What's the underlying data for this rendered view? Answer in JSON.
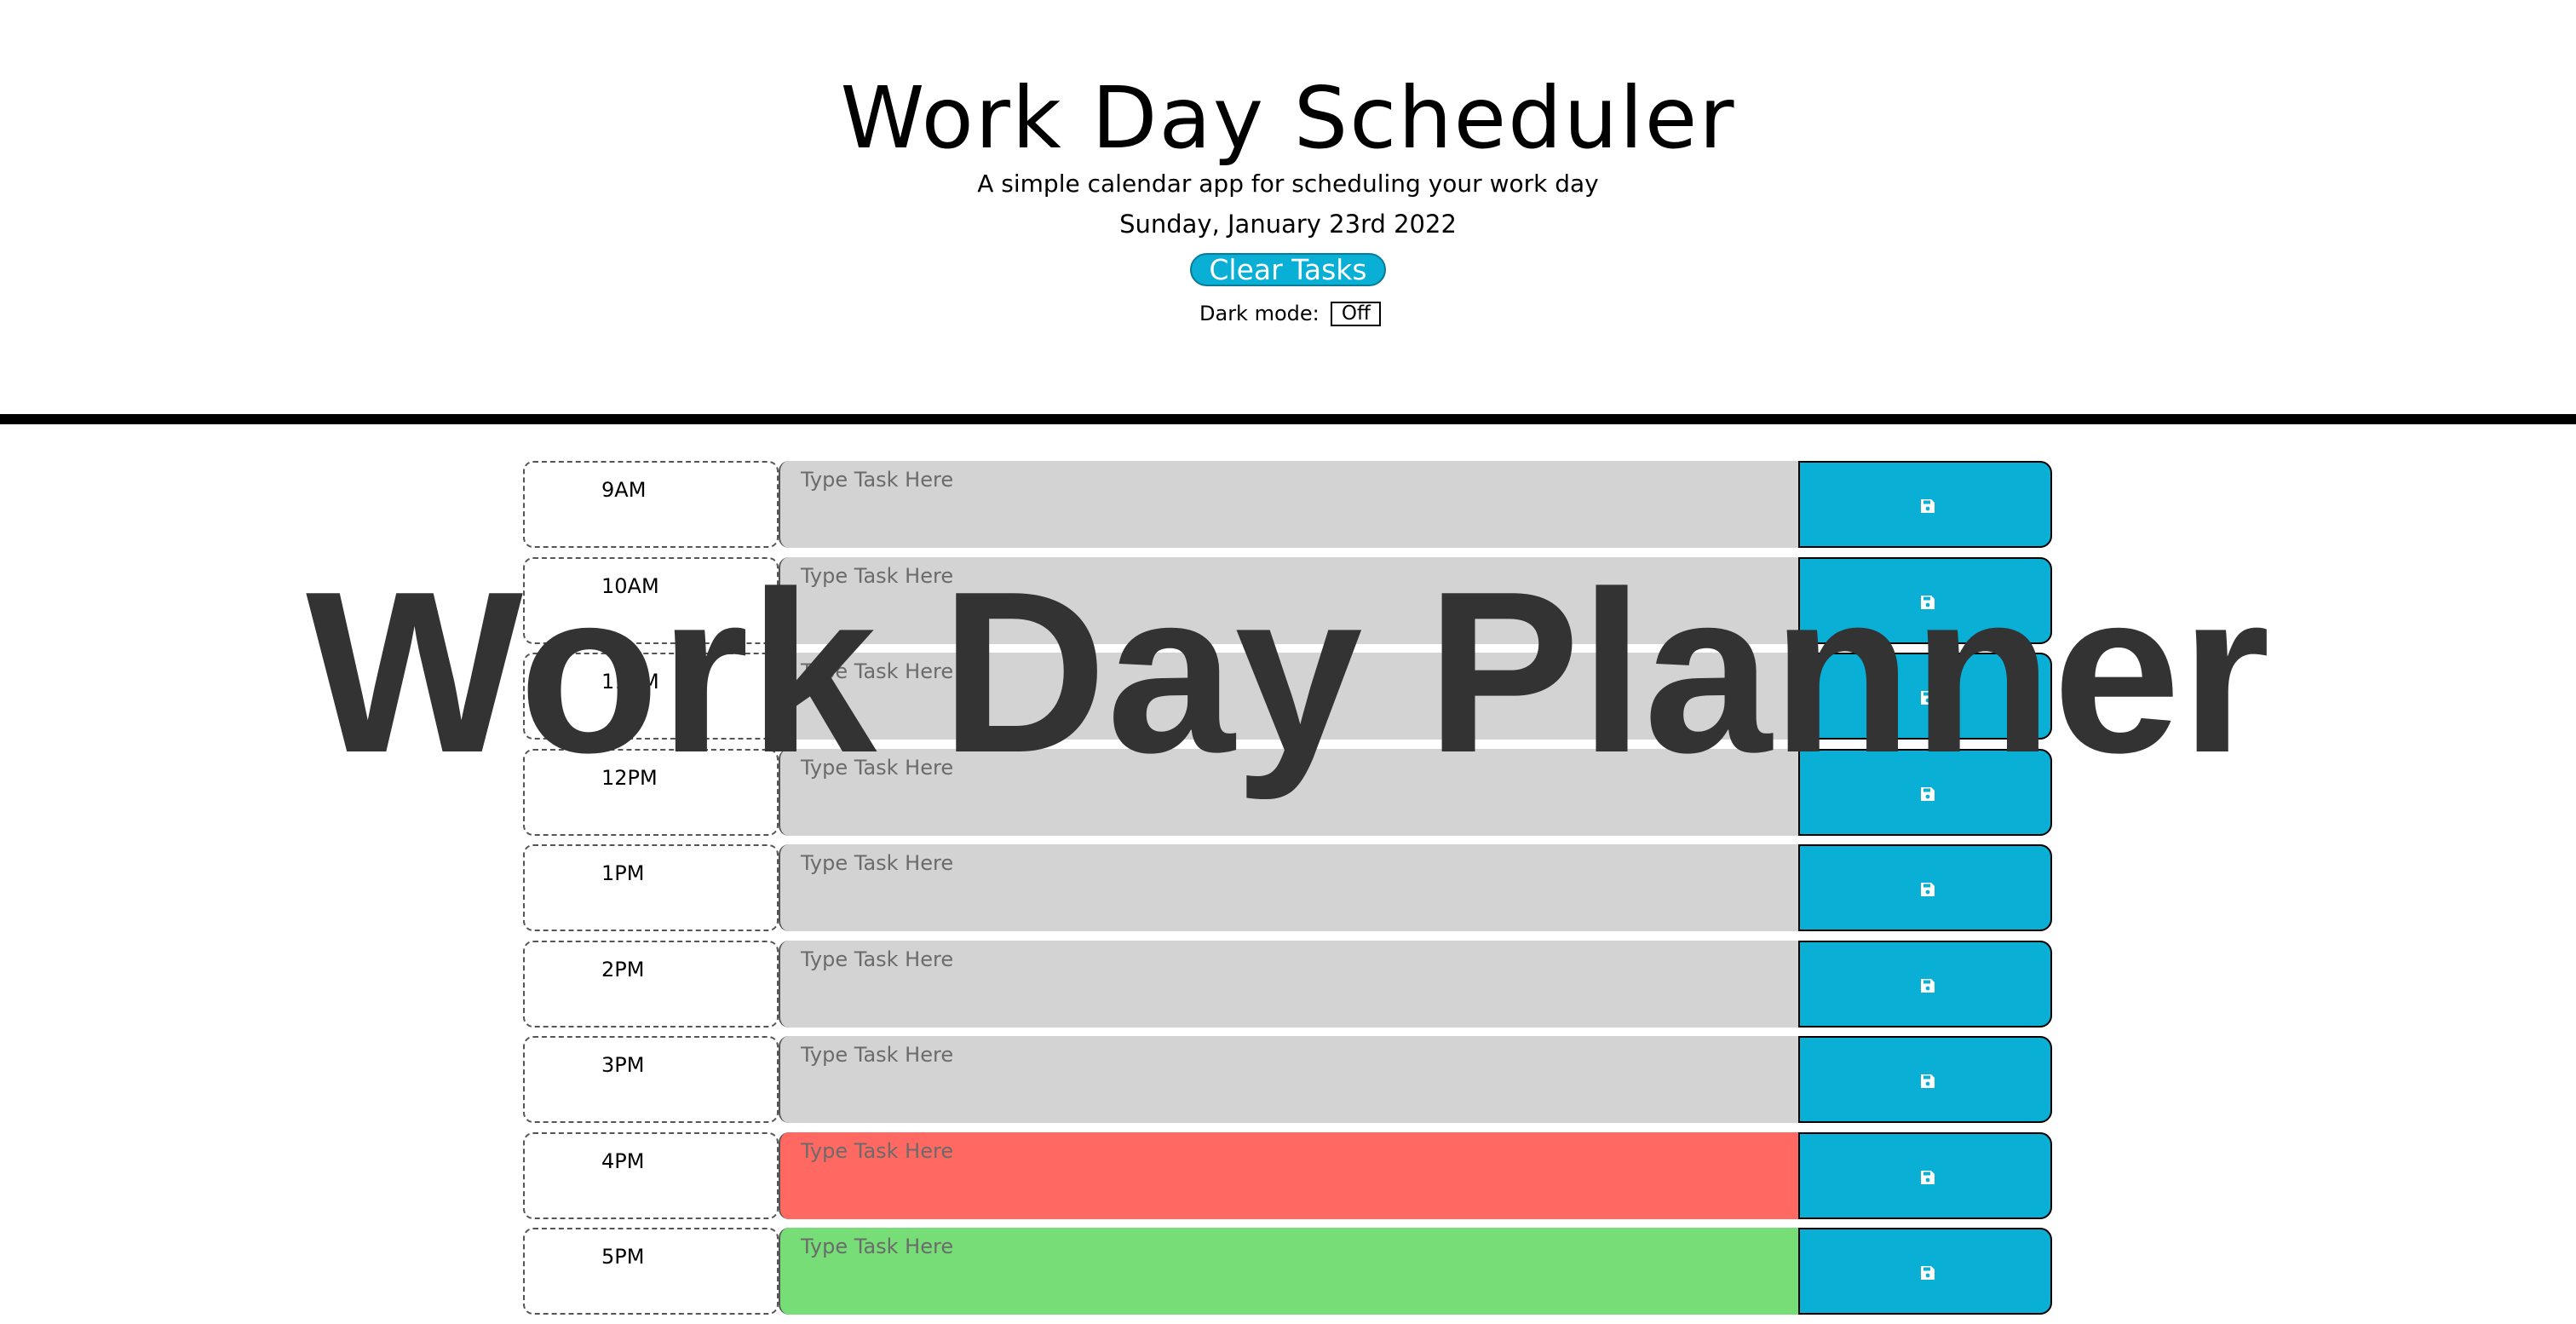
{
  "header": {
    "title": "Work Day Scheduler",
    "subtitle": "A simple calendar app for scheduling your work day",
    "date": "Sunday, January 23rd 2022",
    "clear_label": "Clear Tasks",
    "dark_mode_label": "Dark mode:",
    "dark_mode_value": "Off"
  },
  "watermark": "Work Day Planner",
  "colors": {
    "accent": "#0aafd6",
    "past": "#d3d3d3",
    "present": "#ff6961",
    "future": "#77dd77"
  },
  "rows": [
    {
      "hour": "9AM",
      "placeholder": "Type Task Here",
      "status": "past"
    },
    {
      "hour": "10AM",
      "placeholder": "Type Task Here",
      "status": "past"
    },
    {
      "hour": "11AM",
      "placeholder": "Type Task Here",
      "status": "past"
    },
    {
      "hour": "12PM",
      "placeholder": "Type Task Here",
      "status": "past"
    },
    {
      "hour": "1PM",
      "placeholder": "Type Task Here",
      "status": "past"
    },
    {
      "hour": "2PM",
      "placeholder": "Type Task Here",
      "status": "past"
    },
    {
      "hour": "3PM",
      "placeholder": "Type Task Here",
      "status": "past"
    },
    {
      "hour": "4PM",
      "placeholder": "Type Task Here",
      "status": "present"
    },
    {
      "hour": "5PM",
      "placeholder": "Type Task Here",
      "status": "future"
    }
  ],
  "save_icon": "floppy-disk-icon"
}
